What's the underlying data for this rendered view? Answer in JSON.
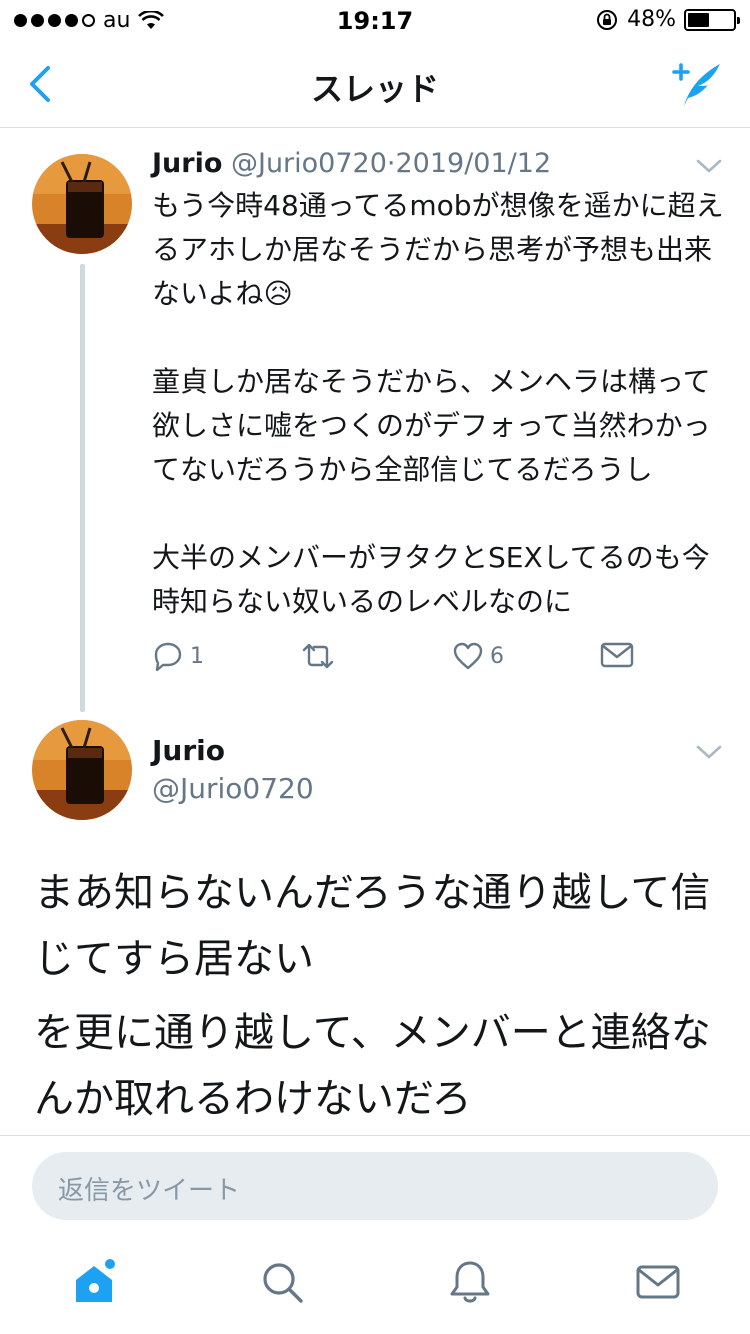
{
  "status_bar": {
    "carrier": "au",
    "time": "19:17",
    "battery": "48%",
    "battery_level": 0.48
  },
  "nav": {
    "title": "スレッド",
    "back_icon": "chevron-left-icon",
    "compose_icon": "compose-tweet-icon"
  },
  "tweet1": {
    "name": "Jurio",
    "handle": "@Jurio0720",
    "separator": "·",
    "date": "2019/01/12",
    "paragraphs": [
      "もう今時48通ってるmobが想像を遥かに超えるアホしか居なそうだから思考が予想も出来ないよね😥",
      "童貞しか居なそうだから、メンヘラは構って欲しさに嘘をつくのがデフォって当然わかってないだろうから全部信じてるだろうし",
      "大半のメンバーがヲタクとSEXしてるのも今時知らない奴いるのレベルなのに"
    ],
    "reply_count": "1",
    "retweet_count": "",
    "like_count": "6"
  },
  "tweet2": {
    "name": "Jurio",
    "handle": "@Jurio0720",
    "paragraphs": [
      "まあ知らないんだろうな通り越して信じてすら居ない",
      "を更に通り越して、メンバーと連絡なんか取れるわけないだろ"
    ]
  },
  "reply_box": {
    "placeholder": "返信をツイート"
  },
  "colors": {
    "accent": "#1da1f2",
    "muted": "#657786",
    "border": "#d8dde2"
  }
}
